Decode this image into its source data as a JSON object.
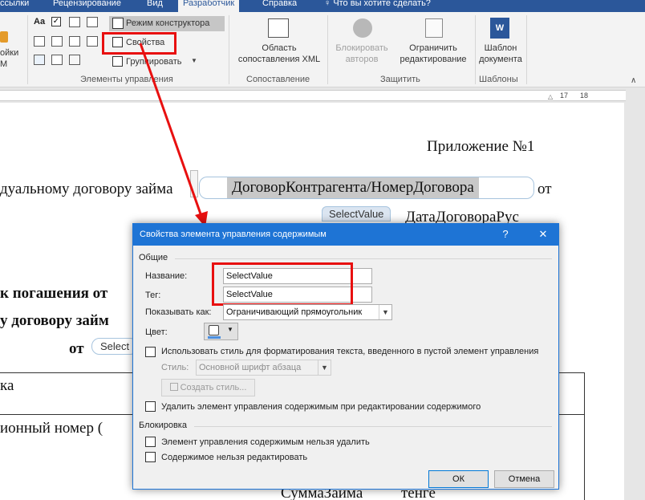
{
  "tabs": [
    {
      "label": "ссылки"
    },
    {
      "label": "Рецензирование"
    },
    {
      "label": "Вид"
    },
    {
      "label": "Разработчик"
    },
    {
      "label": "Справка"
    }
  ],
  "tell_me": "Что вы хотите сделать?",
  "ribbon": {
    "code_group": {
      "line1": "ойки",
      "line2": "M"
    },
    "controls": {
      "design_mode": "Режим конструктора",
      "properties": "Свойства",
      "group": "Группировать",
      "label": "Элементы управления"
    },
    "mapping": {
      "xml_pane_line1": "Область",
      "xml_pane_line2": "сопоставления XML",
      "label": "Сопоставление"
    },
    "protect": {
      "block_line1": "Блокировать",
      "block_line2": "авторов",
      "restrict_line1": "Ограничить",
      "restrict_line2": "редактирование",
      "label": "Защитить"
    },
    "templates": {
      "tpl_line1": "Шаблон",
      "tpl_line2": "документа",
      "label": "Шаблоны"
    }
  },
  "ruler_numbers": [
    "17",
    "18"
  ],
  "document": {
    "appendix": "Приложение №1",
    "line1_prefix": "дуальному договору займа",
    "line1_cc": "ДоговорКонтрагента/НомерДоговора",
    "line1_suffix": "от",
    "line2_cc_title": "SelectValue",
    "line2_cc": "ДатаДоговораРус",
    "bold_line1": "к погашения от",
    "bold_line2": "у договору займ",
    "ot_label": "от",
    "ot_cc": "Select",
    "table_cell1": "ка",
    "table_cell2": "ионный  номер  (",
    "bottom_cc": "СуммаЗайма",
    "bottom_suffix": "тенге"
  },
  "dialog": {
    "title": "Свойства элемента управления содержимым",
    "help": "?",
    "close": "✕",
    "general": "Общие",
    "name_label": "Название:",
    "name_value": "SelectValue",
    "tag_label": "Тег:",
    "tag_value": "SelectValue",
    "show_as_label": "Показывать как:",
    "show_as_value": "Ограничивающий прямоугольник",
    "color_label": "Цвет:",
    "use_style": "Использовать стиль для форматирования текста, введенного в пустой элемент управления",
    "style_label": "Стиль:",
    "style_value": "Основной шрифт абзаца",
    "new_style": "Создать стиль...",
    "remove_cc": "Удалить элемент управления содержимым при редактировании содержимого",
    "locking": "Блокировка",
    "cannot_delete": "Элемент управления содержимым нельзя удалить",
    "cannot_edit": "Содержимое нельзя редактировать",
    "ok": "ОК",
    "cancel": "Отмена"
  },
  "colors": {
    "ribbon_blue": "#2b579a",
    "dialog_blue": "#1e74d5",
    "highlight_red": "#e81010"
  }
}
